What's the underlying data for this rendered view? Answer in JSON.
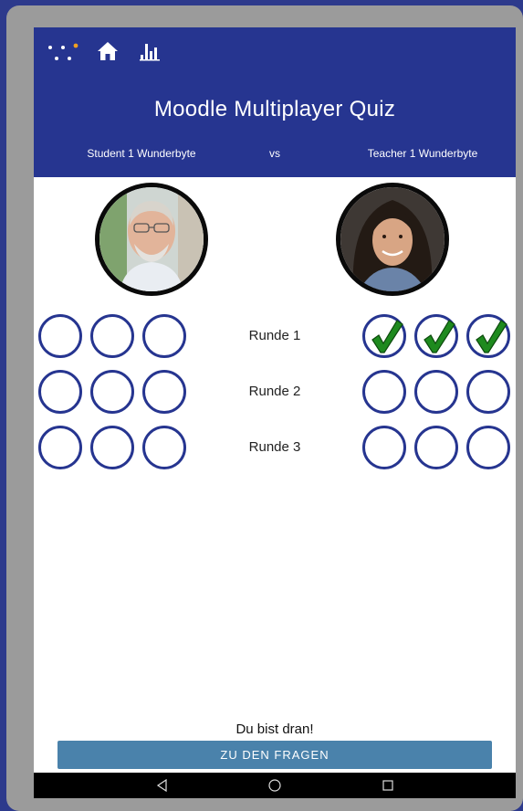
{
  "header": {
    "title": "Moodle Multiplayer Quiz",
    "player_left": "Student 1 Wunderbyte",
    "vs": "vs",
    "player_right": "Teacher 1 Wunderbyte",
    "background_color": "#263590"
  },
  "icons": {
    "menu_logo": "dots-logo-icon",
    "home": "home-icon",
    "stats": "bar-chart-icon"
  },
  "rounds": [
    {
      "label": "Runde 1",
      "left_answers": [
        "empty",
        "empty",
        "empty"
      ],
      "right_answers": [
        "correct",
        "correct",
        "correct"
      ]
    },
    {
      "label": "Runde 2",
      "left_answers": [
        "empty",
        "empty",
        "empty"
      ],
      "right_answers": [
        "empty",
        "empty",
        "empty"
      ]
    },
    {
      "label": "Runde 3",
      "left_answers": [
        "empty",
        "empty",
        "empty"
      ],
      "right_answers": [
        "empty",
        "empty",
        "empty"
      ]
    }
  ],
  "footer": {
    "turn_text": "Du bist dran!",
    "button_label": "ZU DEN FRAGEN",
    "button_color": "#4a82ab"
  },
  "colors": {
    "circle_border": "#263590",
    "check": "#1e8a1e",
    "accent_dot": "#f0a020"
  }
}
